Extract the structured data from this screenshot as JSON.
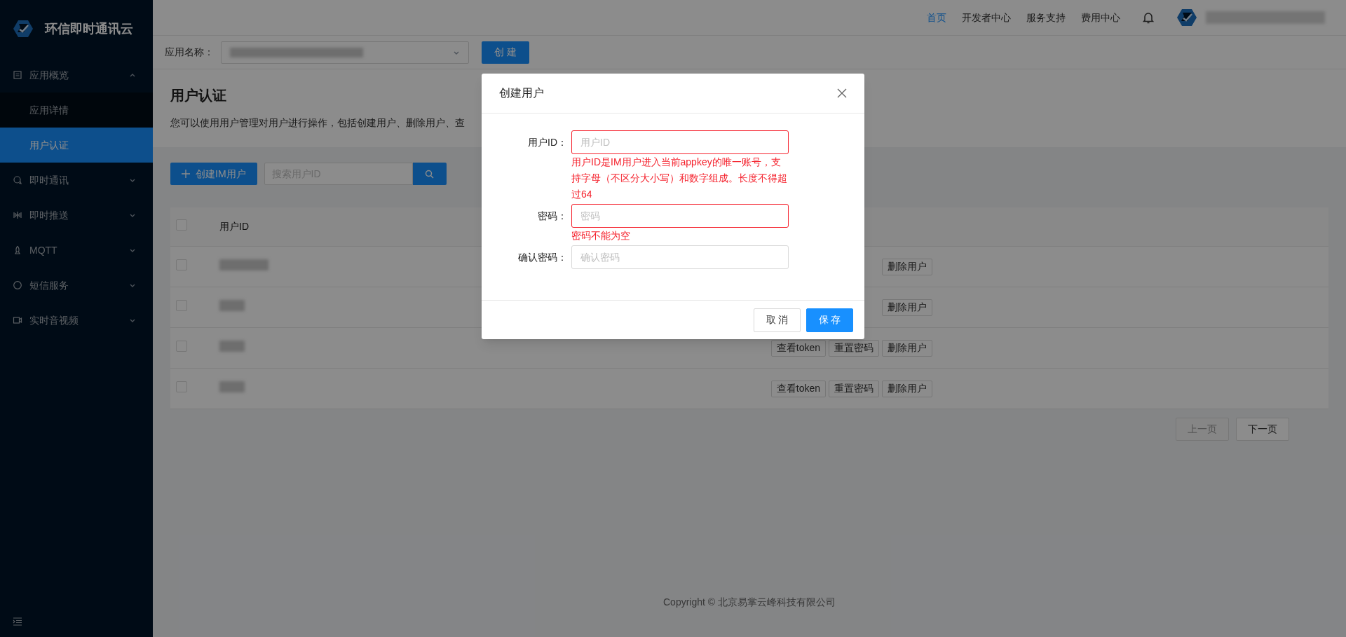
{
  "brand": {
    "name": "环信即时通讯云"
  },
  "sidebar": {
    "items": [
      {
        "label": "应用概览",
        "expanded": true,
        "children": [
          {
            "label": "应用详情",
            "selected": false
          },
          {
            "label": "用户认证",
            "selected": true
          }
        ]
      },
      {
        "label": "即时通讯",
        "expanded": false
      },
      {
        "label": "即时推送",
        "expanded": false
      },
      {
        "label": "MQTT",
        "expanded": false
      },
      {
        "label": "短信服务",
        "expanded": false
      },
      {
        "label": "实时音视频",
        "expanded": false
      }
    ]
  },
  "top_nav": {
    "links": [
      {
        "label": "首页",
        "selected": true
      },
      {
        "label": "开发者中心",
        "selected": false
      },
      {
        "label": "服务支持",
        "selected": false
      },
      {
        "label": "费用中心",
        "selected": false
      }
    ]
  },
  "app_bar": {
    "label": "应用名称：",
    "create_button": "创 建"
  },
  "page": {
    "title": "用户认证",
    "description": "您可以使用用户管理对用户进行操作，包括创建用户、删除用户、查"
  },
  "toolbar": {
    "create_button": "创建IM用户",
    "search": {
      "placeholder": "搜索用户ID"
    }
  },
  "table": {
    "select_all_checked": false,
    "columns": [
      "用户ID"
    ],
    "rows": [
      {
        "checked": false,
        "actions": [
          "删除用户"
        ]
      },
      {
        "checked": false,
        "actions": [
          "删除用户"
        ]
      },
      {
        "checked": false,
        "actions": [
          "查看token",
          "重置密码",
          "删除用户"
        ]
      },
      {
        "checked": false,
        "actions": [
          "查看token",
          "重置密码",
          "删除用户"
        ]
      }
    ]
  },
  "pagination": {
    "prev": {
      "label": "上一页",
      "disabled": true
    },
    "next": {
      "label": "下一页",
      "disabled": false
    }
  },
  "footer": "Copyright © 北京易掌云峰科技有限公司",
  "dialog": {
    "title": "创建用户",
    "fields": [
      {
        "label": "用户ID：",
        "placeholder": "用户ID",
        "invalid": true,
        "error": "用户ID是IM用户进入当前appkey的唯一账号，支持字母（不区分大小写）和数字组成。长度不得超过64"
      },
      {
        "label": "密码：",
        "placeholder": "密码",
        "invalid": true,
        "error": "密码不能为空"
      },
      {
        "label": "确认密码：",
        "placeholder": "确认密码",
        "invalid": false
      }
    ],
    "buttons": [
      {
        "label": "取 消",
        "kind": "default"
      },
      {
        "label": "保 存",
        "kind": "primary"
      }
    ]
  }
}
